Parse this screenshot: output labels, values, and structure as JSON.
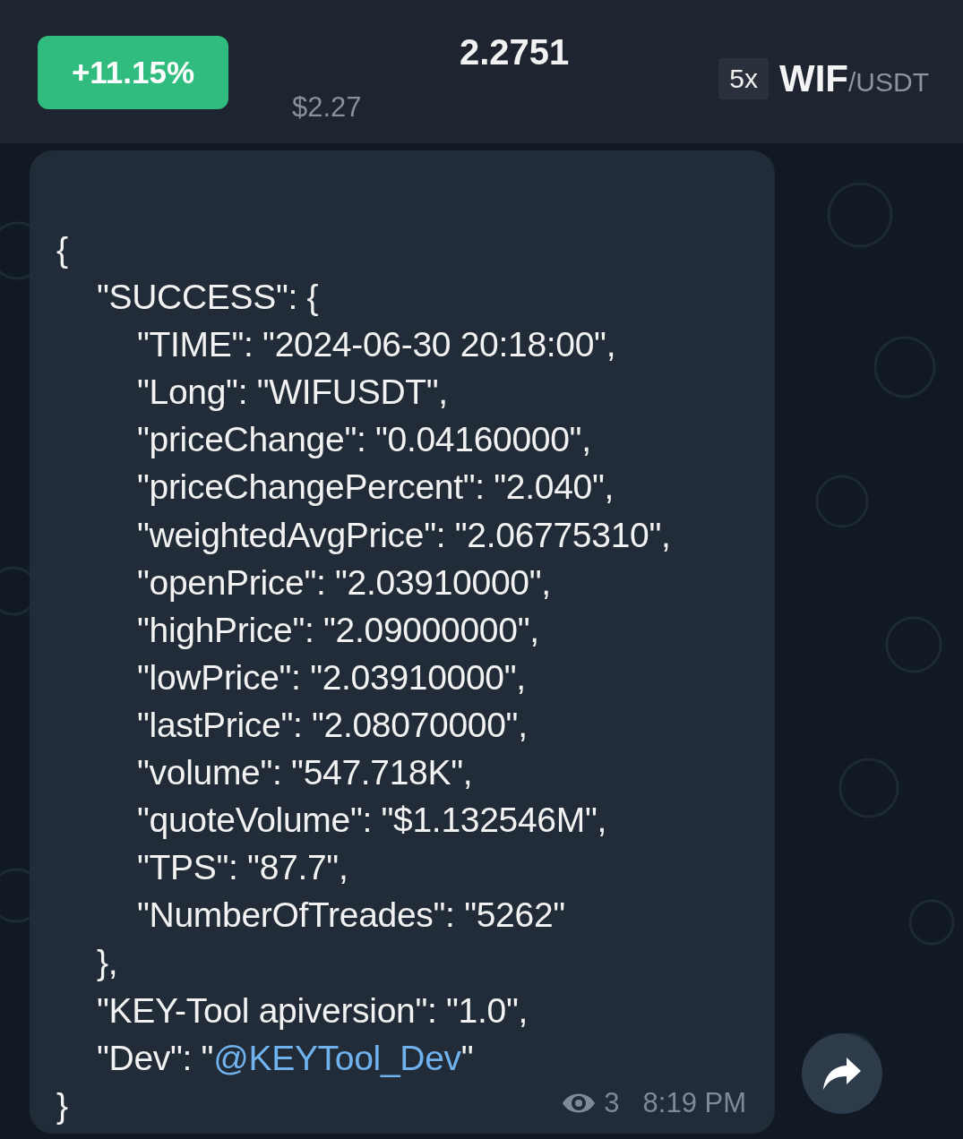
{
  "header": {
    "change_badge": "+11.15%",
    "price": "2.2751",
    "price_usd": "$2.27",
    "leverage": "5x",
    "base": "WIF",
    "quote": "/USDT"
  },
  "message": {
    "lines": [
      {
        "text": "{",
        "children": [
          {
            "text": "\"SUCCESS\": {",
            "children": [
              {
                "text": "\"TIME\": \"2024-06-30 20:18:00\","
              },
              {
                "text": "\"Long\": \"WIFUSDT\","
              },
              {
                "text": "\"priceChange\": \"0.04160000\","
              },
              {
                "text": "\"priceChangePercent\": \"2.040\","
              },
              {
                "text": "\"weightedAvgPrice\": \"2.06775310\","
              },
              {
                "text": "\"openPrice\": \"2.03910000\","
              },
              {
                "text": "\"highPrice\": \"2.09000000\","
              },
              {
                "text": "\"lowPrice\": \"2.03910000\","
              },
              {
                "text": "\"lastPrice\": \"2.08070000\","
              },
              {
                "text": "\"volume\": \"547.718K\","
              },
              {
                "text": "\"quoteVolume\": \"$1.132546M\","
              },
              {
                "text": "\"TPS\": \"87.7\","
              },
              {
                "text": "\"NumberOfTreades\": \"5262\""
              }
            ]
          },
          {
            "text": "},"
          },
          {
            "text": "\"KEY-Tool apiversion\": \"1.0\","
          },
          {
            "text": "\"Dev\": \"",
            "link": "@KEYTool_Dev",
            "after": "\""
          }
        ]
      },
      {
        "text": "}"
      }
    ],
    "views": "3",
    "time": "8:19 PM"
  }
}
